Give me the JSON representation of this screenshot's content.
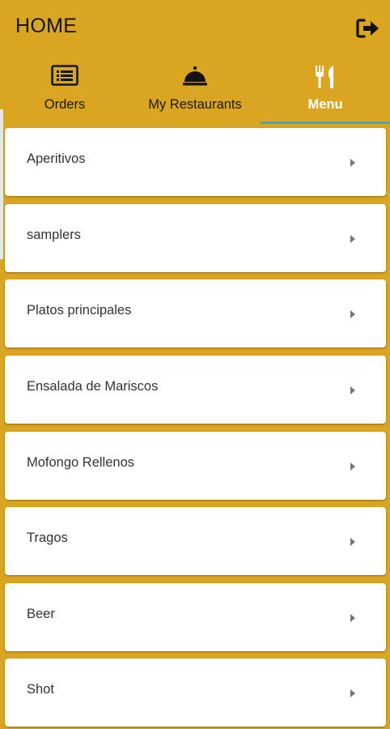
{
  "colors": {
    "primary": "#DAA520",
    "active_tab_text": "#FFFFFF",
    "tab_indicator": "#4AA3C7",
    "card_background": "#FFFFFF"
  },
  "appbar": {
    "title": "HOME",
    "logout_icon": "logout-icon"
  },
  "tabs": [
    {
      "label": "Orders",
      "icon": "list-icon",
      "active": false
    },
    {
      "label": "My Restaurants",
      "icon": "service-bell-icon",
      "active": false
    },
    {
      "label": "Menu",
      "icon": "fork-knife-icon",
      "active": true
    }
  ],
  "menu": {
    "items": [
      {
        "label": "Aperitivos"
      },
      {
        "label": "samplers"
      },
      {
        "label": "Platos principales"
      },
      {
        "label": "Ensalada de Mariscos"
      },
      {
        "label": "Mofongo Rellenos"
      },
      {
        "label": "Tragos"
      },
      {
        "label": "Beer"
      },
      {
        "label": "Shot"
      }
    ]
  }
}
